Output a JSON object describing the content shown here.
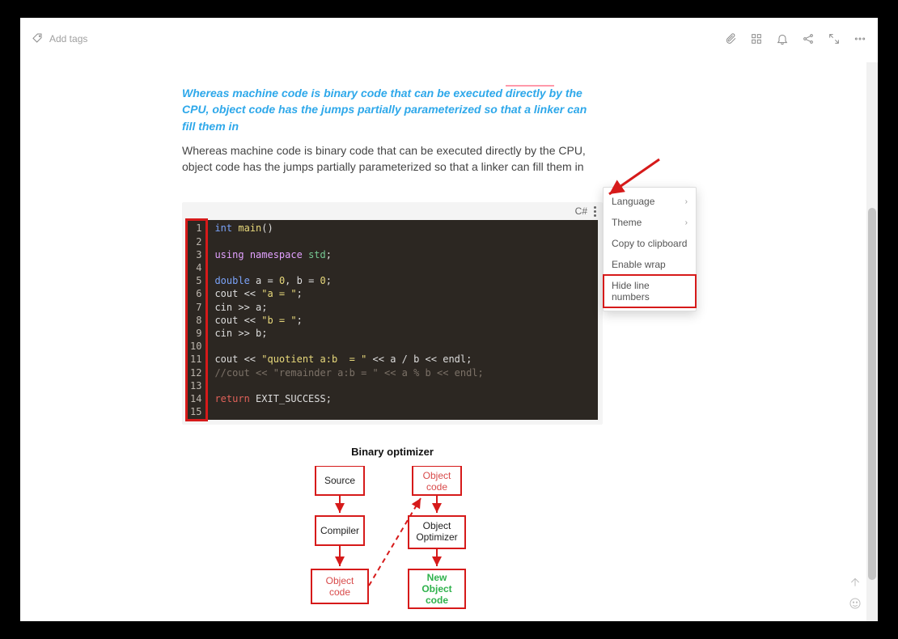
{
  "topbar": {
    "add_tags": "Add tags"
  },
  "text": {
    "quote": "Whereas machine code is binary code that can be executed directly by the CPU, object code has the jumps partially parameterized so that a linker can fill them in",
    "paragraph": "Whereas machine code is binary code that can be executed directly by the CPU, object code has the jumps partially parameterized so that a linker can fill them in"
  },
  "code": {
    "language_label": "C#",
    "line_numbers": [
      "1",
      "2",
      "3",
      "4",
      "5",
      "6",
      "7",
      "8",
      "9",
      "10",
      "11",
      "12",
      "13",
      "14",
      "15"
    ]
  },
  "dropdown": {
    "language": "Language",
    "theme": "Theme",
    "copy": "Copy to clipboard",
    "wrap": "Enable wrap",
    "hide_ln": "Hide line numbers"
  },
  "diagram": {
    "title": "Binary optimizer",
    "source": "Source",
    "compiler": "Compiler",
    "object_code": "Object code",
    "object_optimizer_l1": "Object",
    "object_optimizer_l2": "Optimizer",
    "new_l1": "New",
    "new_l2": "Object",
    "new_l3": "code",
    "oc_l1": "Object",
    "oc_l2": "code"
  }
}
